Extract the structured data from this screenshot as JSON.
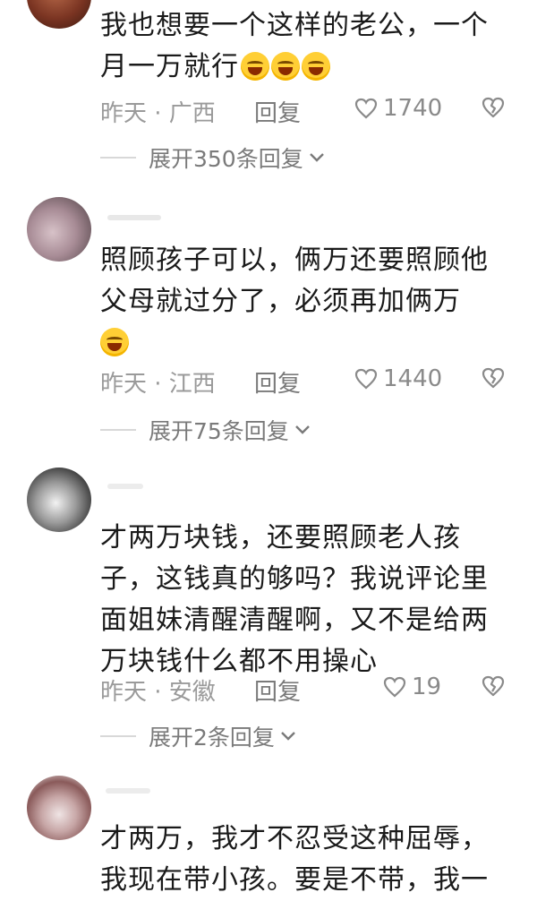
{
  "comments": [
    {
      "text_lines": [
        "我也想要一个这样的老公，一个",
        "月一万就行"
      ],
      "emoji_count": 3,
      "time": "昨天 · 广西",
      "reply": "回复",
      "likes": "1740",
      "expand": "展开350条回复"
    },
    {
      "text_lines": [
        "照顾孩子可以，俩万还要照顾他",
        "父母就过分了，必须再加俩万"
      ],
      "emoji_count": 1,
      "time": "昨天 · 江西",
      "reply": "回复",
      "likes": "1440",
      "expand": "展开75条回复"
    },
    {
      "text_lines": [
        "才两万块钱，还要照顾老人孩",
        "子，这钱真的够吗？我说评论里",
        "面姐妹清醒清醒啊，又不是给两",
        "万块钱什么都不用操心"
      ],
      "time": "昨天 · 安徽",
      "reply": "回复",
      "likes": "19",
      "expand": "展开2条回复"
    },
    {
      "text_lines": [
        "才两万，我才不忍受这种屈辱，",
        "我现在带小孩。要是不带，我一"
      ]
    }
  ],
  "colors": {
    "accent_gray": "#9a9a9a",
    "text": "#1a1a1a",
    "emoji": "#ffcf35"
  }
}
